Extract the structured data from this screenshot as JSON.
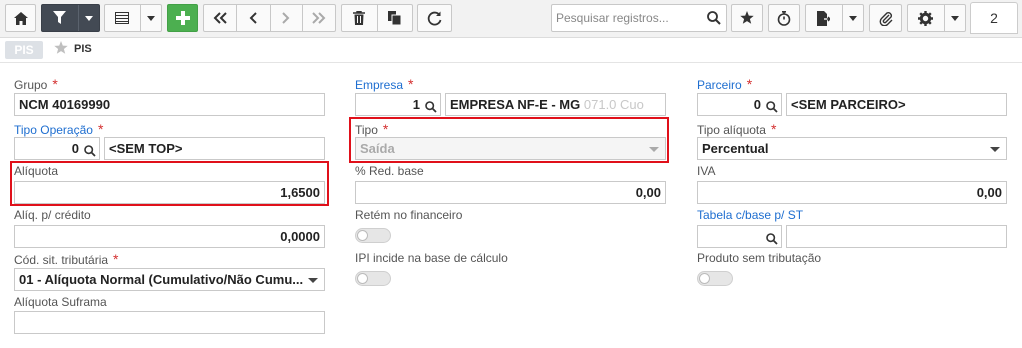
{
  "toolbar": {
    "search_placeholder": "Pesquisar registros...",
    "page_number": "2"
  },
  "tabs": {
    "active_tab": "PIS",
    "breadcrumb": "PIS"
  },
  "form": {
    "grupo": {
      "label": "Grupo",
      "value": "NCM 40169990"
    },
    "empresa": {
      "label": "Empresa",
      "code": "1",
      "name": "EMPRESA NF-E - MG",
      "name_ghost": "071.0 Cuo"
    },
    "parceiro": {
      "label": "Parceiro",
      "code": "0",
      "name": "<SEM PARCEIRO>"
    },
    "tipo_operacao": {
      "label": "Tipo Operação",
      "code": "0",
      "name": "<SEM TOP>"
    },
    "tipo": {
      "label": "Tipo",
      "value": "Saída"
    },
    "tipo_aliquota": {
      "label": "Tipo alíquota",
      "value": "Percentual"
    },
    "aliquota": {
      "label": "Alíquota",
      "value": "1,6500"
    },
    "red_base": {
      "label": "% Red. base",
      "value": "0,00"
    },
    "iva": {
      "label": "IVA",
      "value": "0,00"
    },
    "aliq_credito": {
      "label": "Alíq. p/ crédito",
      "value": "0,0000"
    },
    "retem_financeiro": {
      "label": "Retém no financeiro",
      "on": false
    },
    "tabela_base_st": {
      "label": "Tabela c/base p/ ST",
      "code": "",
      "name": ""
    },
    "cod_sit_tributaria": {
      "label": "Cód. sit. tributária",
      "value": "01 - Alíquota Normal (Cumulativo/Não Cumu..."
    },
    "ipi_base_calculo": {
      "label": "IPI incide na base de cálculo",
      "on": false
    },
    "produto_sem_tributacao": {
      "label": "Produto sem tributação",
      "on": false
    },
    "aliquota_suframa": {
      "label": "Alíquota Suframa",
      "value": ""
    }
  },
  "required_mark": "*"
}
